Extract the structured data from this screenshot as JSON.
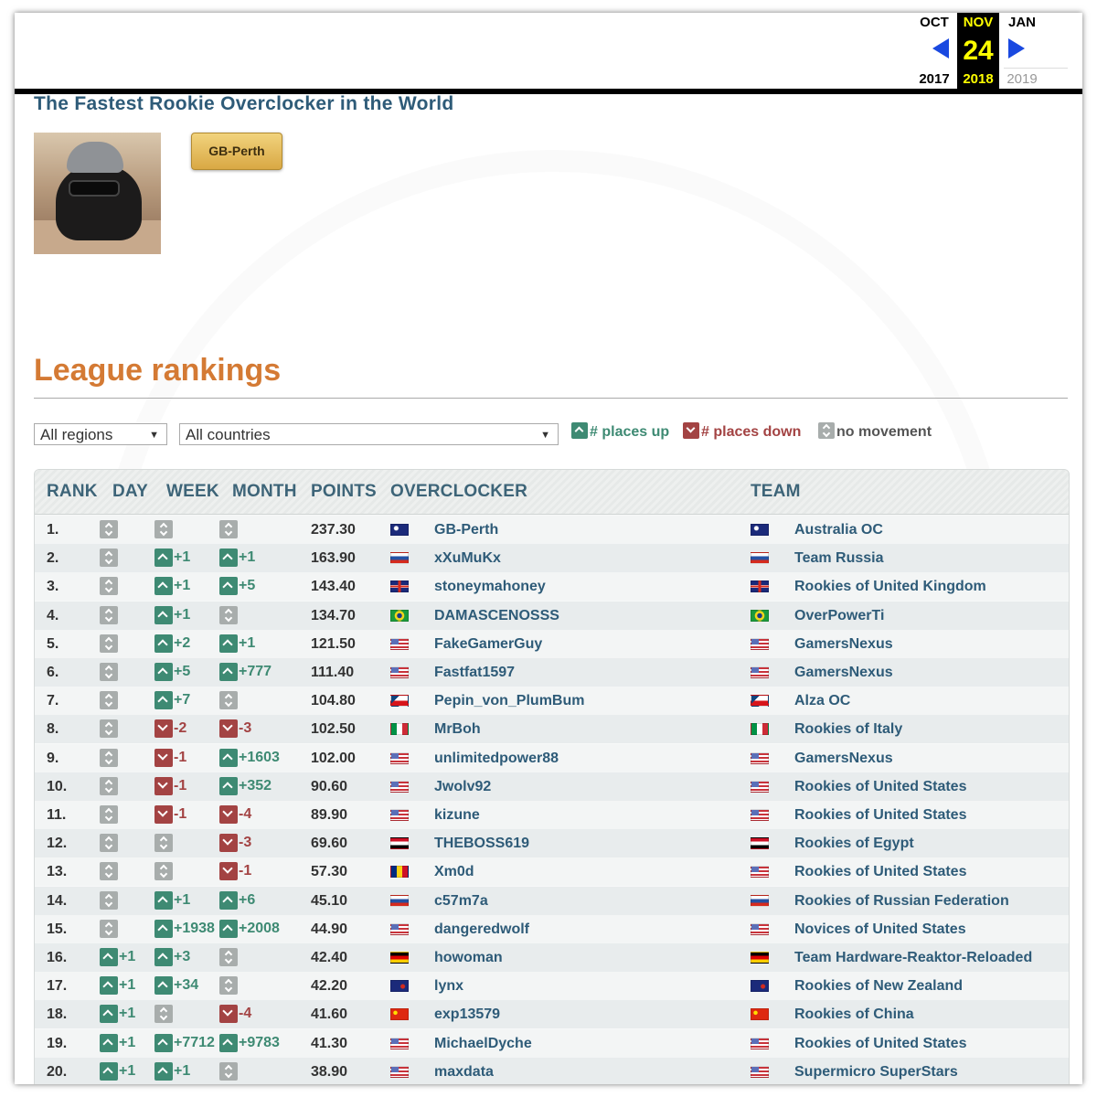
{
  "wayback": {
    "prev": {
      "month": "OCT",
      "year": "2017"
    },
    "current": {
      "month": "NOV",
      "day": "24",
      "year": "2018"
    },
    "next": {
      "month": "JAN",
      "year": "2019"
    }
  },
  "profile": {
    "subtitle": "The Fastest Rookie Overclocker in the World",
    "badge_label": "GB-Perth"
  },
  "league": {
    "title": "League rankings",
    "region_select": "All regions",
    "country_select": "All countries",
    "legend": {
      "up": "# places up",
      "down": "# places down",
      "none": "no movement"
    },
    "columns": {
      "rank": "RANK",
      "day": "DAY",
      "week": "WEEK",
      "month": "MONTH",
      "points": "POINTS",
      "overclocker": "OVERCLOCKER",
      "team": "TEAM"
    },
    "colors": {
      "up": "#3e8a73",
      "down": "#a34343",
      "none": "#a8adac",
      "accent": "#d47a34",
      "link": "#2e5b78"
    },
    "rows": [
      {
        "rank": "1.",
        "day": "",
        "week": "",
        "month": "",
        "points": "237.30",
        "name": "GB-Perth",
        "flag": "au",
        "team": "Australia OC",
        "team_flag": "au"
      },
      {
        "rank": "2.",
        "day": "",
        "week": "+1",
        "month": "+1",
        "points": "163.90",
        "name": "xXuMuKx",
        "flag": "ru",
        "team": "Team Russia",
        "team_flag": "ru"
      },
      {
        "rank": "3.",
        "day": "",
        "week": "+1",
        "month": "+5",
        "points": "143.40",
        "name": "stoneymahoney",
        "flag": "gb",
        "team": "Rookies of United Kingdom",
        "team_flag": "gb"
      },
      {
        "rank": "4.",
        "day": "",
        "week": "+1",
        "month": "",
        "points": "134.70",
        "name": "DAMASCENOSSS",
        "flag": "br",
        "team": "OverPowerTi",
        "team_flag": "br"
      },
      {
        "rank": "5.",
        "day": "",
        "week": "+2",
        "month": "+1",
        "points": "121.50",
        "name": "FakeGamerGuy",
        "flag": "us",
        "team": "GamersNexus",
        "team_flag": "us"
      },
      {
        "rank": "6.",
        "day": "",
        "week": "+5",
        "month": "+777",
        "points": "111.40",
        "name": "Fastfat1597",
        "flag": "us",
        "team": "GamersNexus",
        "team_flag": "us"
      },
      {
        "rank": "7.",
        "day": "",
        "week": "+7",
        "month": "",
        "points": "104.80",
        "name": "Pepin_von_PlumBum",
        "flag": "cz",
        "team": "Alza OC",
        "team_flag": "cz"
      },
      {
        "rank": "8.",
        "day": "",
        "week": "-2",
        "month": "-3",
        "points": "102.50",
        "name": "MrBoh",
        "flag": "it",
        "team": "Rookies of Italy",
        "team_flag": "it"
      },
      {
        "rank": "9.",
        "day": "",
        "week": "-1",
        "month": "+1603",
        "points": "102.00",
        "name": "unlimitedpower88",
        "flag": "us",
        "team": "GamersNexus",
        "team_flag": "us"
      },
      {
        "rank": "10.",
        "day": "",
        "week": "-1",
        "month": "+352",
        "points": "90.60",
        "name": "Jwolv92",
        "flag": "us",
        "team": "Rookies of United States",
        "team_flag": "us"
      },
      {
        "rank": "11.",
        "day": "",
        "week": "-1",
        "month": "-4",
        "points": "89.90",
        "name": "kizune",
        "flag": "us",
        "team": "Rookies of United States",
        "team_flag": "us"
      },
      {
        "rank": "12.",
        "day": "",
        "week": "",
        "month": "-3",
        "points": "69.60",
        "name": "THEBOSS619",
        "flag": "eg",
        "team": "Rookies of Egypt",
        "team_flag": "eg"
      },
      {
        "rank": "13.",
        "day": "",
        "week": "",
        "month": "-1",
        "points": "57.30",
        "name": "Xm0d",
        "flag": "ro",
        "team": "Rookies of United States",
        "team_flag": "us"
      },
      {
        "rank": "14.",
        "day": "",
        "week": "+1",
        "month": "+6",
        "points": "45.10",
        "name": "c57m7a",
        "flag": "ru",
        "team": "Rookies of Russian Federation",
        "team_flag": "ru"
      },
      {
        "rank": "15.",
        "day": "",
        "week": "+1938",
        "month": "+2008",
        "points": "44.90",
        "name": "dangeredwolf",
        "flag": "us",
        "team": "Novices of United States",
        "team_flag": "us"
      },
      {
        "rank": "16.",
        "day": "+1",
        "week": "+3",
        "month": "",
        "points": "42.40",
        "name": "howoman",
        "flag": "de",
        "team": "Team Hardware-Reaktor-Reloaded",
        "team_flag": "de"
      },
      {
        "rank": "17.",
        "day": "+1",
        "week": "+34",
        "month": "",
        "points": "42.20",
        "name": "lynx",
        "flag": "nz",
        "team": "Rookies of New Zealand",
        "team_flag": "nz"
      },
      {
        "rank": "18.",
        "day": "+1",
        "week": "",
        "month": "-4",
        "points": "41.60",
        "name": "exp13579",
        "flag": "cn",
        "team": "Rookies of China",
        "team_flag": "cn"
      },
      {
        "rank": "19.",
        "day": "+1",
        "week": "+7712",
        "month": "+9783",
        "points": "41.30",
        "name": "MichaelDyche",
        "flag": "us",
        "team": "Rookies of United States",
        "team_flag": "us"
      },
      {
        "rank": "20.",
        "day": "+1",
        "week": "+1",
        "month": "",
        "points": "38.90",
        "name": "maxdata",
        "flag": "us",
        "team": "Supermicro SuperStars",
        "team_flag": "us"
      }
    ]
  }
}
